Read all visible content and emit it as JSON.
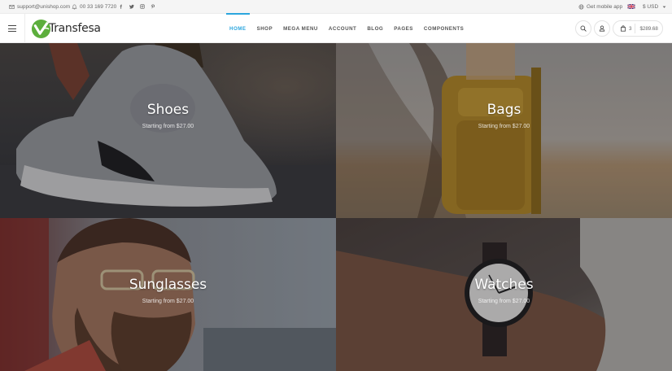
{
  "topbar": {
    "email": "support@unishop.com",
    "phone": "00 33 169 7720",
    "social": [
      "facebook-icon",
      "twitter-icon",
      "instagram-icon",
      "pinterest-icon"
    ],
    "mobile_app": "Get mobile app",
    "currency": "$ USD"
  },
  "header": {
    "logo_text": "Transfesa",
    "nav": [
      {
        "label": "HOME",
        "active": true
      },
      {
        "label": "SHOP",
        "active": false
      },
      {
        "label": "MEGA MENU",
        "active": false
      },
      {
        "label": "ACCOUNT",
        "active": false
      },
      {
        "label": "BLOG",
        "active": false
      },
      {
        "label": "PAGES",
        "active": false
      },
      {
        "label": "COMPONENTS",
        "active": false
      }
    ],
    "cart_count": "3",
    "cart_total": "$289.68"
  },
  "categories": [
    {
      "title": "Shoes",
      "subtitle": "Starting from $27.00"
    },
    {
      "title": "Bags",
      "subtitle": "Starting from $27.00"
    },
    {
      "title": "Sunglasses",
      "subtitle": "Starting from $27.00"
    },
    {
      "title": "Watches",
      "subtitle": "Starting from $27.00"
    }
  ],
  "colors": {
    "accent": "#2ba6de",
    "logo_green": "#5cae3c",
    "topbar_bg": "#f5f5f5"
  }
}
